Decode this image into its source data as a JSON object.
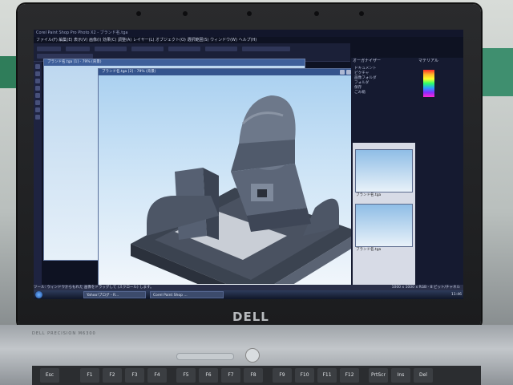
{
  "app": {
    "title": "Corel Paint Shop Pro Photo X2 - ブランド名.tga",
    "menus": [
      "ファイル(F)",
      "編集(E)",
      "表示(V)",
      "画像(I)",
      "効果(C)",
      "調整(A)",
      "レイヤー(L)",
      "オブジェクト(O)",
      "選択範囲(S)",
      "ウィンドウ(W)",
      "ヘルプ(H)"
    ],
    "windows": {
      "back_title": "ブランド名.tga [1] - 79% (背景)",
      "front_title": "ブランド名.tga [2] - 79% (背景)"
    },
    "organizer_title": "オーガナイザー",
    "material_title": "マテリアル",
    "tree_items": [
      "ドキュメント",
      "ピクチャ",
      "画像フォルダ",
      "フォルダ",
      "保存",
      "ごみ箱"
    ],
    "thumbnails": [
      {
        "label": "ブランド名.tga"
      },
      {
        "label": "ブランド名.tga"
      }
    ],
    "status_left": "ツール: ウィンドウからもれた 画像をドラッグして (スクロール) します。",
    "status_right": "1000 x 1000 x RGB - 8 ビット/チャネル"
  },
  "taskbar": {
    "items": [
      "Yahoo!ブログ - R...",
      "Corel Paint Shop ..."
    ],
    "clock": "11:46"
  },
  "hardware": {
    "brand": "DELL",
    "model": "DELL PRECISION M6300"
  },
  "keys": [
    "Esc",
    "F1",
    "F2",
    "F3",
    "F4",
    "F5",
    "F6",
    "F7",
    "F8",
    "F9",
    "F10",
    "F11",
    "F12",
    "PrtScr",
    "Ins",
    "Del"
  ]
}
